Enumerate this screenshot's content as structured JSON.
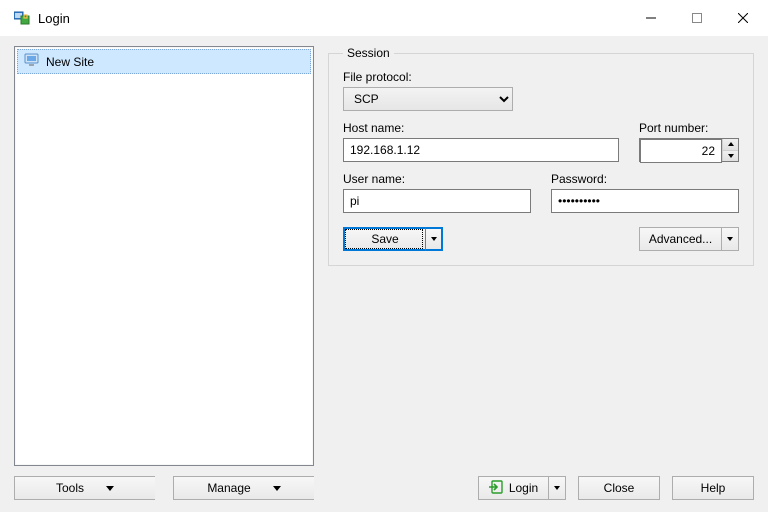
{
  "window": {
    "title": "Login"
  },
  "sites": {
    "items": [
      {
        "label": "New Site"
      }
    ]
  },
  "sites_buttons": {
    "tools": "Tools",
    "manage": "Manage"
  },
  "session": {
    "legend": "Session",
    "protocol_label": "File protocol:",
    "protocol_value": "SCP",
    "host_label": "Host name:",
    "host_value": "192.168.1.12",
    "port_label": "Port number:",
    "port_value": "22",
    "user_label": "User name:",
    "user_value": "pi",
    "password_label": "Password:",
    "password_value": "••••••••••",
    "save_label": "Save",
    "advanced_label": "Advanced..."
  },
  "bottom": {
    "login": "Login",
    "close": "Close",
    "help": "Help"
  }
}
